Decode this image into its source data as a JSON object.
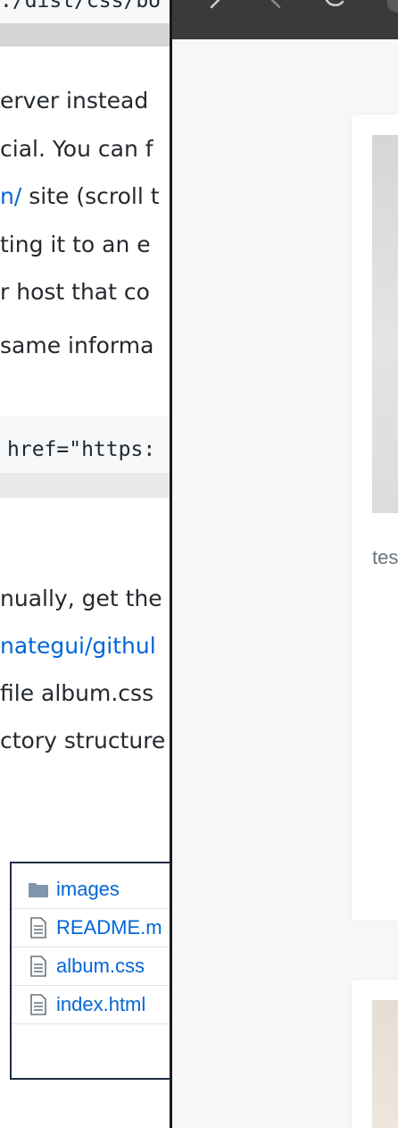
{
  "document": {
    "code_top": ":/dist/css/bo",
    "lines": [
      {
        "text": "erver instead"
      },
      {
        "text": "cial. You can f"
      },
      {
        "link": "n/",
        "text": " site (scroll t"
      },
      {
        "text": "ting it to an e"
      },
      {
        "text": "r host that co"
      },
      {
        "text": " same informa"
      }
    ],
    "code_href": "href=\"https:",
    "lines2": [
      {
        "text": "nually, get the"
      },
      {
        "link": "nategui/githul",
        "text": ""
      },
      {
        "text": "file album.css"
      },
      {
        "text": "ctory structure"
      }
    ],
    "files": [
      {
        "icon": "folder-icon",
        "name": "images"
      },
      {
        "icon": "file-icon",
        "name": "README.m"
      },
      {
        "icon": "file-icon",
        "name": "album.css"
      },
      {
        "icon": "file-icon",
        "name": "index.html"
      }
    ]
  },
  "browser": {
    "card1": {
      "caption": "tes"
    },
    "colors": {
      "toolbar": "#3a3a3a",
      "background": "#f7f7f7",
      "link": "#0366d6",
      "caption": "#6c757d"
    }
  }
}
